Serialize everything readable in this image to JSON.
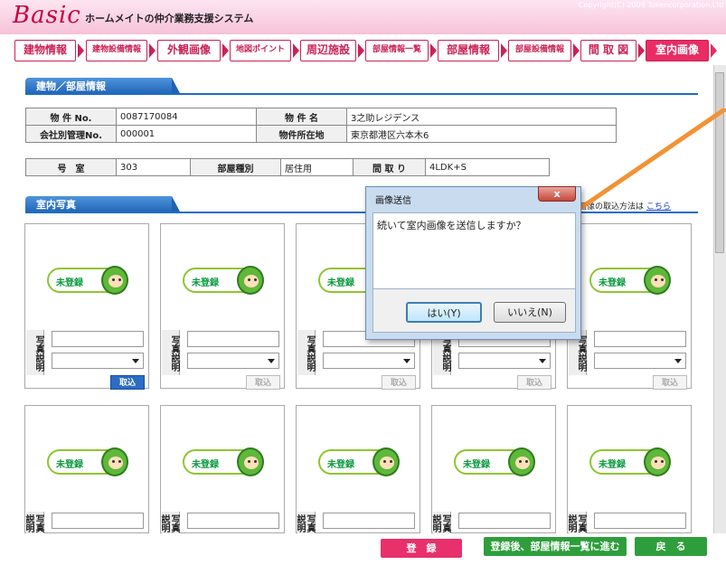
{
  "header": {
    "logo": "Basic",
    "system_title": "ホームメイトの仲介業務支援システム",
    "copyright": "Copyright(C) 2009 Tokencorporation,Ltd"
  },
  "nav": {
    "tabs": [
      {
        "label": "建物情報"
      },
      {
        "label": "建物設備情報"
      },
      {
        "label": "外観画像"
      },
      {
        "label": "地図ポイント"
      },
      {
        "label": "周辺施設"
      },
      {
        "label": "部屋情報一覧"
      },
      {
        "label": "部屋情報"
      },
      {
        "label": "部屋設備情報"
      },
      {
        "label": "間 取 図"
      },
      {
        "label": "室内画像"
      }
    ],
    "active": "室内画像"
  },
  "building_section": {
    "title": "建物／部屋情報",
    "property_no_label": "物 件 No.",
    "property_no": "0087170084",
    "property_name_label": "物 件 名",
    "property_name": "3之助レジデンス",
    "company_no_label": "会社別管理No.",
    "company_no": "000001",
    "location_label": "物件所在地",
    "location": "東京都港区六本木6",
    "room_label": "号　室",
    "room": "303",
    "room_type_label": "部屋種別",
    "room_type": "居住用",
    "layout_label": "間 取 り",
    "layout": "4LDK+S"
  },
  "photos_section": {
    "title": "室内写真",
    "hint_text": "画像の取込方法は",
    "hint_link": "こちら",
    "unregistered_label": "未登録",
    "desc_label": "写真説明",
    "load_label": "取込"
  },
  "footer": {
    "register_label": "登　録",
    "register_next_label": "登録後、部屋情報一覧に進む",
    "back_label": "戻　る"
  },
  "dialog": {
    "title": "画像送信",
    "close": "x",
    "message": "続いて室内画像を送信しますか？",
    "yes_label": "はい(Y)",
    "no_label": "いいえ(N)"
  }
}
